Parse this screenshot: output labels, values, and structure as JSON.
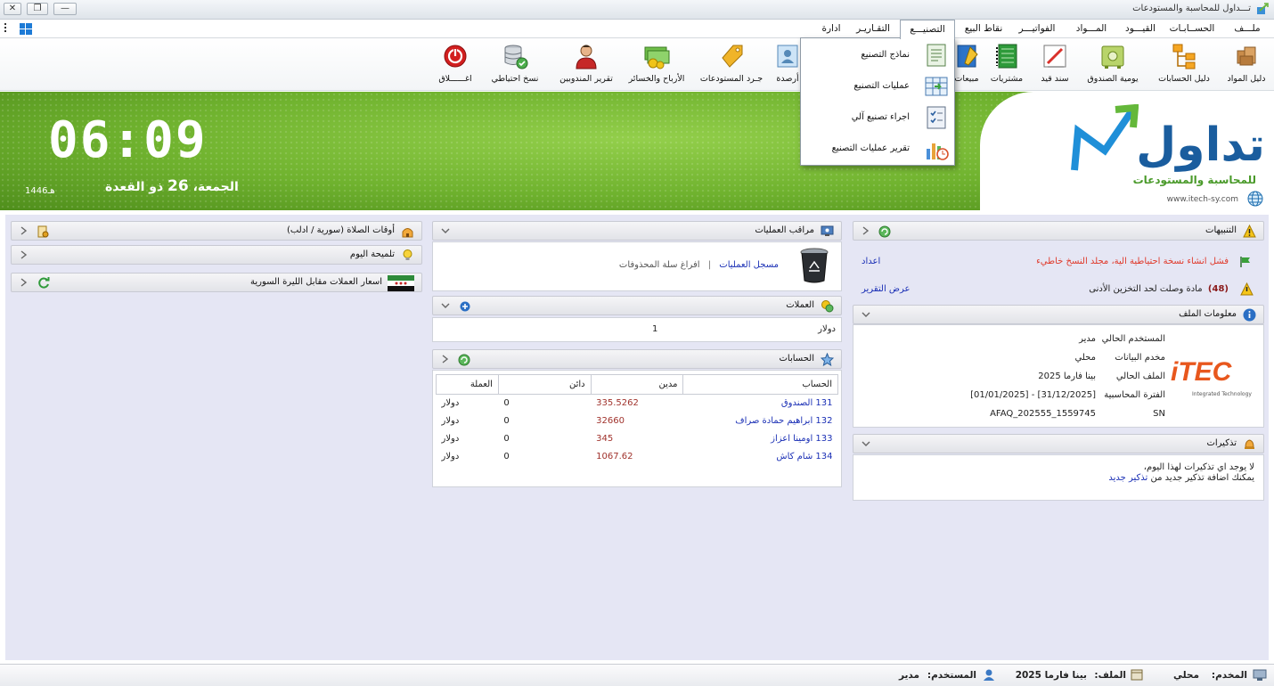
{
  "window": {
    "title": "تـــداول للمحاسبة والمستودعات",
    "close_glyph": "✕",
    "restore_glyph": "❐",
    "minimize_glyph": "—"
  },
  "menu": {
    "items": [
      {
        "label": "ملـــف"
      },
      {
        "label": "الحســابـات"
      },
      {
        "label": "القيـــود"
      },
      {
        "label": "المـــواد"
      },
      {
        "label": "الفواتيـــر"
      },
      {
        "label": "نقاط البيع"
      },
      {
        "label": "التصنيـــع"
      },
      {
        "label": "التقـاريـر"
      },
      {
        "label": "ادارة"
      }
    ],
    "active": "التصنيـــع"
  },
  "toolbar": {
    "buttons": [
      {
        "label": "دليل المواد",
        "icon": "boxes-icon"
      },
      {
        "label": "دليل الحسابات",
        "icon": "accounts-tree-icon"
      },
      {
        "label": "يومية الصندوق",
        "icon": "safe-icon"
      },
      {
        "label": "سند قيد",
        "icon": "journal-pen-icon"
      },
      {
        "label": "مشتريات",
        "icon": "purchases-book-icon"
      },
      {
        "label": "مبيعات",
        "icon": "sales-notebook-icon"
      },
      {
        "label": "أرصدة",
        "icon": "balances-icon"
      },
      {
        "label": "جـرد المستودعات",
        "icon": "inventory-tag-icon"
      },
      {
        "label": "الأرباح والخسائر",
        "icon": "money-icon"
      },
      {
        "label": "تقرير المندوبين",
        "icon": "representative-icon"
      },
      {
        "label": "نسخ احتياطي",
        "icon": "database-backup-icon"
      },
      {
        "label": "اغــــــلاق",
        "icon": "power-icon"
      }
    ]
  },
  "dropdown": {
    "items": [
      {
        "label": "نماذج التصنيع",
        "icon": "form-document-icon"
      },
      {
        "label": "عمليات التصنيع",
        "icon": "process-table-icon"
      },
      {
        "label": "اجراء تصنيع آلي",
        "icon": "checklist-icon"
      },
      {
        "label": "تقرير عمليات التصنيع",
        "icon": "chart-clock-icon"
      }
    ]
  },
  "banner": {
    "time": "06:09",
    "day_name": "الجمعة،",
    "day_num": "26",
    "month": "ذو القعدة",
    "hijri_year": "1446هـ",
    "brand": "تداول",
    "brand_sub": "للمحاسبة والمستودعات",
    "website": "www.itech-sy.com"
  },
  "alerts": {
    "title": "التنبيهات",
    "items": [
      {
        "text": "فشل انشاء نسخة احتياطية الية، مجلد النسخ خاطيء",
        "action": "اعداد"
      },
      {
        "count": "(48)",
        "text": "مادة وصلت لحد التخزين الأدنى",
        "action": "عرض التقرير"
      }
    ]
  },
  "file_info": {
    "title": "معلومات الملف",
    "rows": [
      {
        "label": "المستخدم الحالي",
        "value": "مدير"
      },
      {
        "label": "مخدم البيانات",
        "value": "محلي"
      },
      {
        "label": "الملف الحالي",
        "value": "بينا فارما 2025"
      },
      {
        "label": "الفترة المحاسبية",
        "value": "[01/01/2025] - [31/12/2025]"
      },
      {
        "label": "SN",
        "value": "AFAQ_202555_1559745"
      }
    ],
    "logo_text": "iTEC",
    "logo_sub": "Integrated Technology"
  },
  "reminders": {
    "title": "تذكيرات",
    "line1": "لا يوجد اي تذكيرات لهذا اليوم،",
    "line2_prefix": "يمكنك اضافة تذكير جديد من",
    "line2_link": "تذكير جديد"
  },
  "operations": {
    "title": "مراقب العمليات",
    "log_link": "مسجل العمليات",
    "separator": "|",
    "empty_trash": "افراغ سلة المحذوفات"
  },
  "currencies": {
    "title": "العملات",
    "rows": [
      {
        "name": "دولار",
        "value": "1"
      }
    ]
  },
  "accounts": {
    "title": "الحسابات",
    "columns": [
      "الحساب",
      "مدين",
      "دائن",
      "العملة"
    ],
    "rows": [
      {
        "account": "131 الصندوق",
        "debit": "335.5262",
        "credit": "0",
        "currency": "دولار"
      },
      {
        "account": "132 ابراهيم حمادة صراف",
        "debit": "32660",
        "credit": "0",
        "currency": "دولار"
      },
      {
        "account": "133 اومينا اعزاز",
        "debit": "345",
        "credit": "0",
        "currency": "دولار"
      },
      {
        "account": "134 شام كاش",
        "debit": "1067.62",
        "credit": "0",
        "currency": "دولار"
      }
    ]
  },
  "side": {
    "prayer_title": "أوقات الصلاة (سورية / ادلب)",
    "tip_title": "تلميحة اليوم",
    "rates_title": "اسعار العملات مقابل الليرة السورية"
  },
  "status": {
    "server_label": "المخدم:",
    "server_value": "محلي",
    "file_label": "الملف:",
    "file_value": "بينا فارما 2025",
    "user_label": "المستخدم:",
    "user_value": "مدير"
  },
  "colors": {
    "banner_green": "#6fb22e",
    "link_blue": "#1a2fb5",
    "alert_red": "#e0392a",
    "main_bg": "#e5e6f4"
  }
}
